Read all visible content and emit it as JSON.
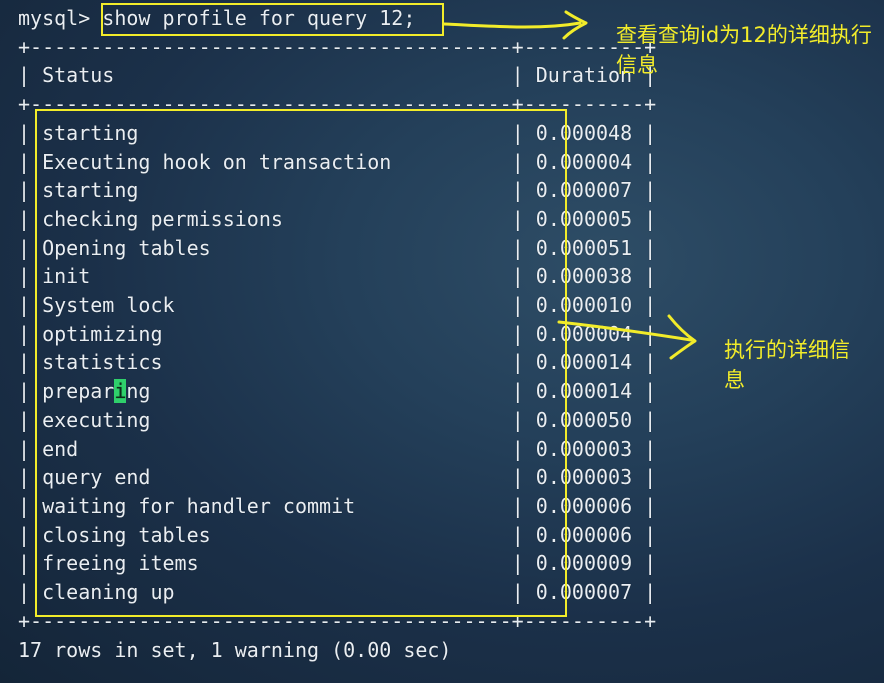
{
  "terminal": {
    "prompt": "mysql> ",
    "command": "show profile for query 12;",
    "separator": "+----------------------------------------+----------+",
    "header": "| Status                                 | Duration |",
    "rows": [
      {
        "status": "starting",
        "duration": "0.000048"
      },
      {
        "status": "Executing hook on transaction",
        "duration": "0.000004"
      },
      {
        "status": "starting",
        "duration": "0.000007"
      },
      {
        "status": "checking permissions",
        "duration": "0.000005"
      },
      {
        "status": "Opening tables",
        "duration": "0.000051"
      },
      {
        "status": "init",
        "duration": "0.000038"
      },
      {
        "status": "System lock",
        "duration": "0.000010"
      },
      {
        "status": "optimizing",
        "duration": "0.000004"
      },
      {
        "status": "statistics",
        "duration": "0.000014"
      },
      {
        "status": "preparing",
        "duration": "0.000014"
      },
      {
        "status": "executing",
        "duration": "0.000050"
      },
      {
        "status": "end",
        "duration": "0.000003"
      },
      {
        "status": "query end",
        "duration": "0.000003"
      },
      {
        "status": "waiting for handler commit",
        "duration": "0.000006"
      },
      {
        "status": "closing tables",
        "duration": "0.000006"
      },
      {
        "status": "freeing items",
        "duration": "0.000009"
      },
      {
        "status": "cleaning up",
        "duration": "0.000007"
      }
    ],
    "summary": "17 rows in set, 1 warning (0.00 sec)"
  },
  "annotations": {
    "query_note": "查看查询id为12的详细执行信息",
    "detail_note": "执行的详细信息"
  },
  "colors": {
    "highlight": "#f2ec2a",
    "cursor": "#2fd06b",
    "background": "#1f3852"
  }
}
